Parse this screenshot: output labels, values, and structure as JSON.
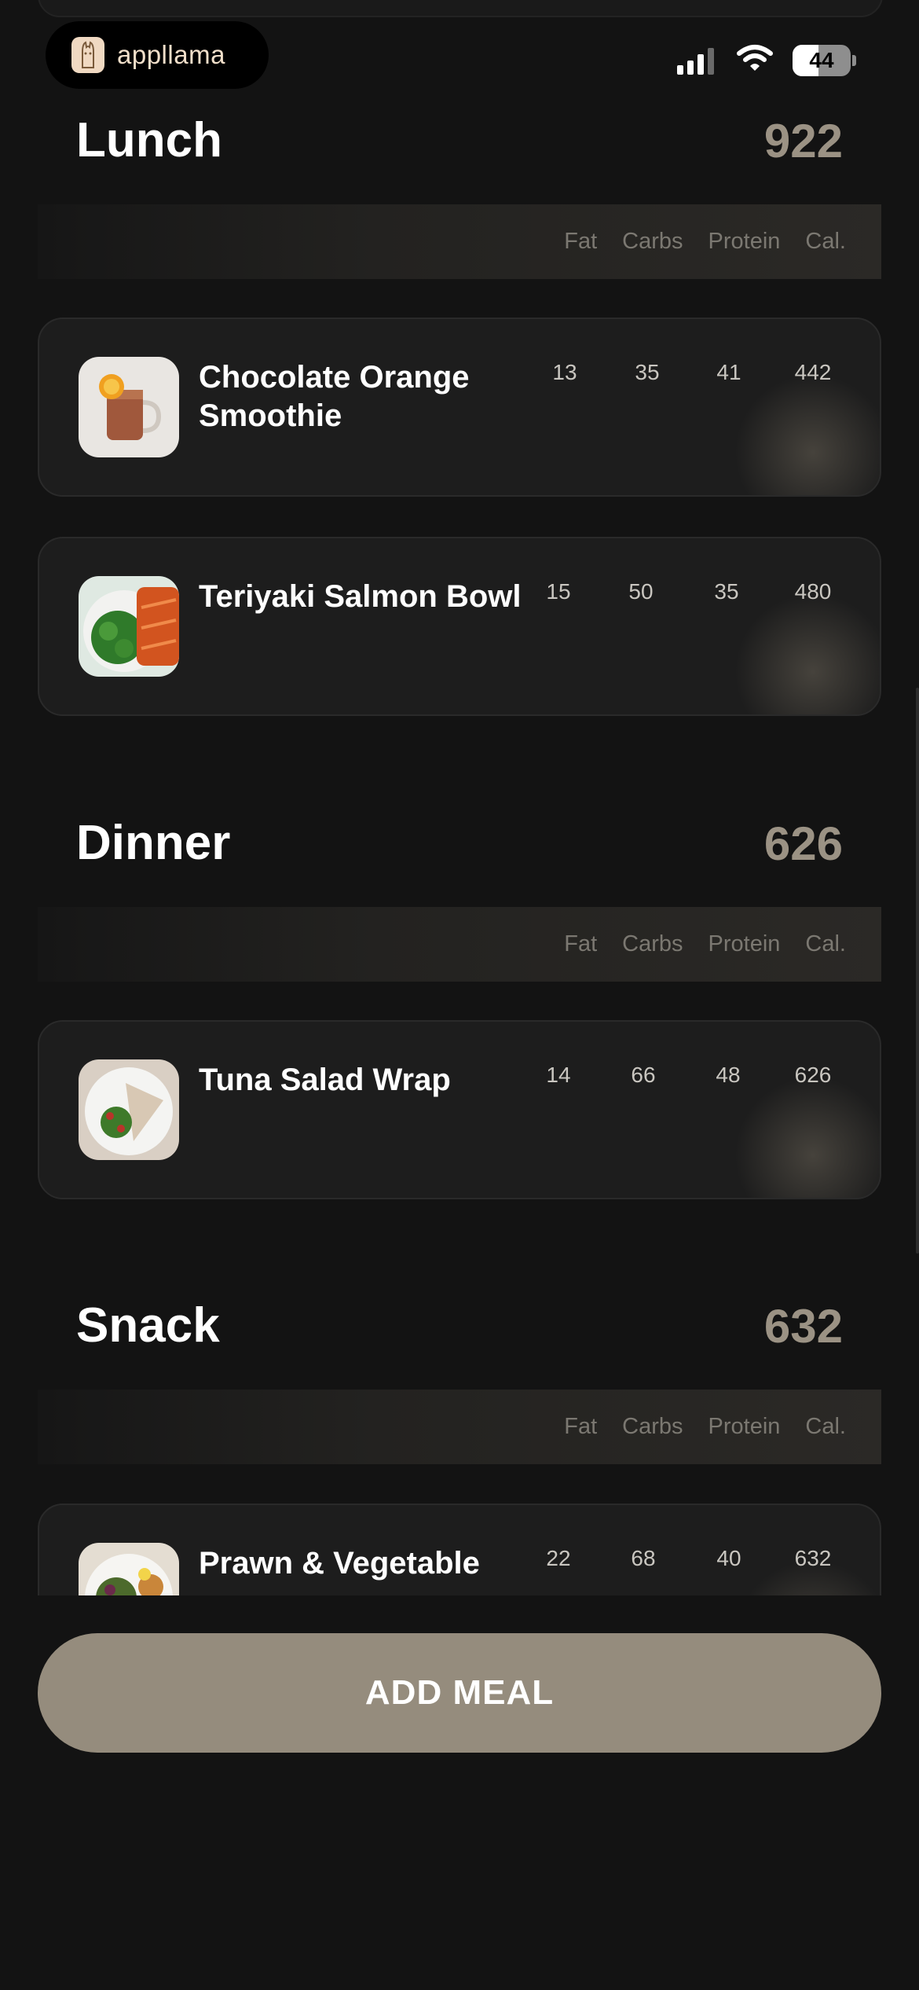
{
  "status_bar": {
    "app_name": "appllama",
    "battery_level": "44"
  },
  "columns": {
    "fat": "Fat",
    "carbs": "Carbs",
    "protein": "Protein",
    "cal": "Cal."
  },
  "sections": [
    {
      "title": "Lunch",
      "total": "922",
      "meals": [
        {
          "name": "Chocolate Orange Smoothie",
          "fat": "13",
          "carbs": "35",
          "protein": "41",
          "cal": "442"
        },
        {
          "name": "Teriyaki Salmon Bowl",
          "fat": "15",
          "carbs": "50",
          "protein": "35",
          "cal": "480"
        }
      ]
    },
    {
      "title": "Dinner",
      "total": "626",
      "meals": [
        {
          "name": "Tuna Salad Wrap",
          "fat": "14",
          "carbs": "66",
          "protein": "48",
          "cal": "626"
        }
      ]
    },
    {
      "title": "Snack",
      "total": "632",
      "meals": [
        {
          "name": "Prawn & Vegetable",
          "fat": "22",
          "carbs": "68",
          "protein": "40",
          "cal": "632"
        }
      ]
    }
  ],
  "add_meal_label": "ADD MEAL",
  "colors": {
    "background": "#131313",
    "accent": "#958c7d",
    "total_text": "#9b9284"
  }
}
